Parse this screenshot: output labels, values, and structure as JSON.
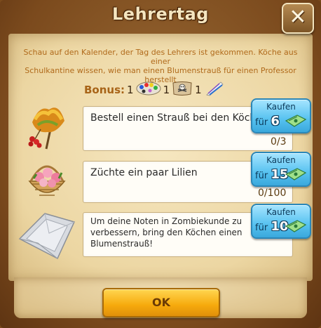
{
  "dialog": {
    "title": "Lehrertag",
    "close_icon": "close-x-icon",
    "description_line1": "Schau auf den Kalender, der Tag des Lehrers ist gekommen. Köche aus einer",
    "description_line2": "Schulkantine wissen, wie man einen Blumenstrauß für einen Professor herstellt"
  },
  "bonus": {
    "label": "Bonus:",
    "items": [
      {
        "count": "1",
        "icon": "paint-palette-icon"
      },
      {
        "count": "1",
        "icon": "treasure-map-icon"
      },
      {
        "count": "1",
        "icon": "feather-quills-icon"
      }
    ]
  },
  "tasks": [
    {
      "text": "Bestell einen Strauß bei den Köchen!",
      "progress": "0/3",
      "icon": "flower-bouquet-icon",
      "buy_label": "Kaufen",
      "buy_prefix": "für",
      "buy_price": "6"
    },
    {
      "text": "Züchte ein paar Lilien",
      "progress": "0/100",
      "icon": "lily-basket-icon",
      "buy_label": "Kaufen",
      "buy_prefix": "für",
      "buy_price": "15"
    },
    {
      "text": "Um deine Noten in Zombiekunde zu verbessern, bring den Köchen einen Blumenstrauß!",
      "progress": "",
      "icon": "wrapping-paper-icon",
      "buy_label": "Kaufen",
      "buy_prefix": "für",
      "buy_price": "10"
    }
  ],
  "ok_button": "OK",
  "currency_icon": "banknote-icon",
  "colors": {
    "frame": "#7b4a1d",
    "parchment": "#f0dcab",
    "description_text": "#b06a1b",
    "buy_button": "#57c2f0",
    "ok_button": "#f6a90c"
  }
}
